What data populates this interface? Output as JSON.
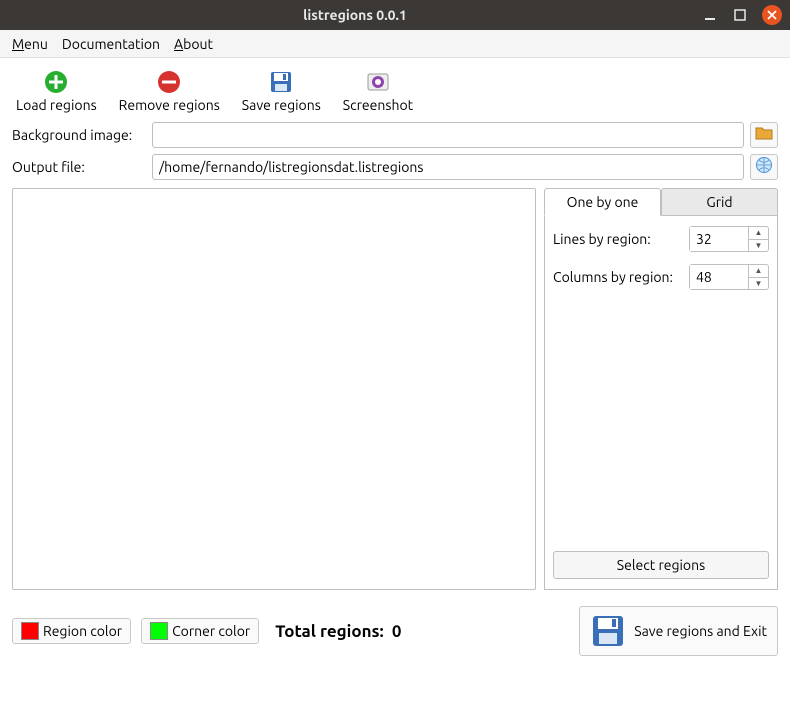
{
  "window": {
    "title": "listregions 0.0.1"
  },
  "menu": {
    "items": [
      "Menu",
      "Documentation",
      "About"
    ],
    "underlines": [
      0,
      0,
      0
    ]
  },
  "toolbar": {
    "load": "Load regions",
    "remove": "Remove regions",
    "save": "Save regions",
    "screenshot": "Screenshot"
  },
  "form": {
    "bg_label": "Background image:",
    "bg_value": "",
    "out_label": "Output file:",
    "out_value": "/home/fernando/listregionsdat.listregions"
  },
  "tabs": {
    "one": "One by one",
    "grid": "Grid",
    "active": "one",
    "lines_label": "Lines by region:",
    "lines_value": "32",
    "cols_label": "Columns by region:",
    "cols_value": "48",
    "select_btn": "Select regions"
  },
  "bottom": {
    "region_color_label": "Region color",
    "region_color": "#ff0000",
    "corner_color_label": "Corner color",
    "corner_color": "#00ff00",
    "total_label": "Total regions:",
    "total_value": "0",
    "save_exit": "Save regions and Exit"
  }
}
